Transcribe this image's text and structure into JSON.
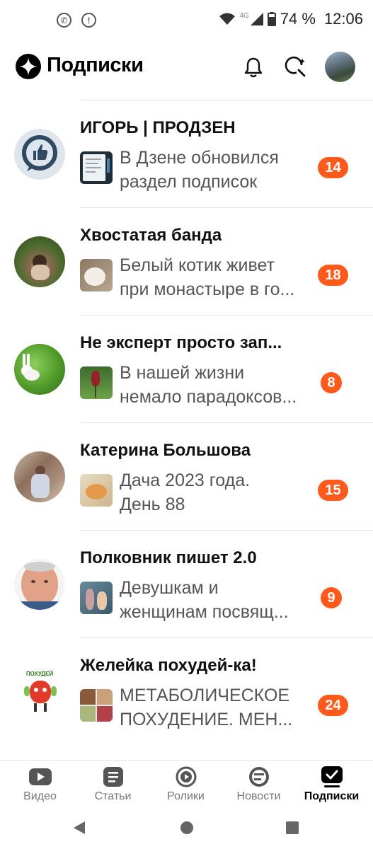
{
  "status_bar": {
    "network": "4G",
    "battery": "74 %",
    "time": "12:06"
  },
  "header": {
    "title": "Подписки",
    "icons": [
      "zen-logo-icon",
      "bell-icon",
      "search-sparkle-icon",
      "profile-avatar"
    ]
  },
  "feed": {
    "items": [
      {
        "channel": "ИГОРЬ | ПРОДЗЕН",
        "line1": "В Дзене обновился",
        "line2": "раздел подписок",
        "count": "14"
      },
      {
        "channel": "Хвостатая банда",
        "line1": "Белый котик живет",
        "line2": "при монастыре в го...",
        "count": "18"
      },
      {
        "channel": "Не эксперт просто зап...",
        "line1": "В нашей жизни",
        "line2": "немало парадоксов...",
        "count": "8"
      },
      {
        "channel": "Катерина Большова",
        "line1": "Дача 2023 года.",
        "line2": "День 88",
        "count": "15"
      },
      {
        "channel": "Полковник пишет 2.0",
        "line1": "Девушкам и",
        "line2": "женщинам посвящ...",
        "count": "9"
      },
      {
        "channel": "Желейка похудей-ка!",
        "line1": "МЕТАБОЛИЧЕСКОЕ",
        "line2": "ПОХУДЕНИЕ. МЕН...",
        "count": "24"
      }
    ],
    "avatar_caption_6": "ПОХУДЕЙ"
  },
  "bottom_nav": {
    "items": [
      {
        "label": "Видео",
        "icon": "video-icon"
      },
      {
        "label": "Статьи",
        "icon": "articles-icon"
      },
      {
        "label": "Ролики",
        "icon": "clips-icon"
      },
      {
        "label": "Новости",
        "icon": "news-icon"
      },
      {
        "label": "Подписки",
        "icon": "subscriptions-icon",
        "active": true
      }
    ]
  },
  "colors": {
    "badge": "#fe5a1c",
    "active_nav": "#000000",
    "inactive_nav": "#777777"
  }
}
